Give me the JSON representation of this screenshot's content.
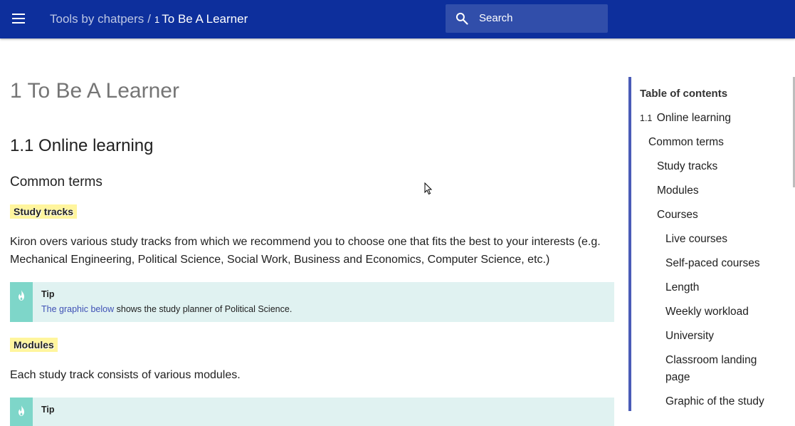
{
  "header": {
    "site_title": "Tools by chatpers",
    "separator": "/",
    "page_number": "1",
    "page_title": "To Be A Learner",
    "search_placeholder": "Search"
  },
  "main": {
    "title": "1 To Be A Learner",
    "section_title": "1.1 Online learning",
    "subsection_title": "Common terms",
    "study_tracks": {
      "label": "Study tracks",
      "paragraph": "Kiron overs various study tracks from which we recommend you to choose one that fits the best to your interests (e.g. Mechanical Engineering, Political Science, Social Work, Business and Economics, Computer Science, etc.)",
      "tip": {
        "title": "Tip",
        "link_text": "The graphic below",
        "body_text": " shows the study planner of Political Science."
      }
    },
    "modules": {
      "label": "Modules",
      "paragraph": "Each study track consists of various modules.",
      "tip": {
        "title": "Tip"
      }
    }
  },
  "toc": {
    "title": "Table of contents",
    "items": [
      {
        "number": "1.1",
        "label": "Online learning"
      },
      {
        "label": "Common terms"
      },
      {
        "label": "Study tracks"
      },
      {
        "label": "Modules"
      },
      {
        "label": "Courses"
      },
      {
        "label": "Live courses"
      },
      {
        "label": "Self-paced courses"
      },
      {
        "label": "Length"
      },
      {
        "label": "Weekly workload"
      },
      {
        "label": "University"
      },
      {
        "label": "Classroom landing page"
      },
      {
        "label": "Graphic of the study"
      }
    ]
  },
  "icons": {
    "menu": "menu-icon",
    "search": "search-icon",
    "tip": "flame-icon"
  },
  "colors": {
    "header_bg": "#0d2f9c",
    "toc_border": "#4a5bb7",
    "tip_bg": "#e0f2f1",
    "tip_accent": "#7ed6c9",
    "highlight": "#fff59d",
    "link": "#3f51b5"
  }
}
